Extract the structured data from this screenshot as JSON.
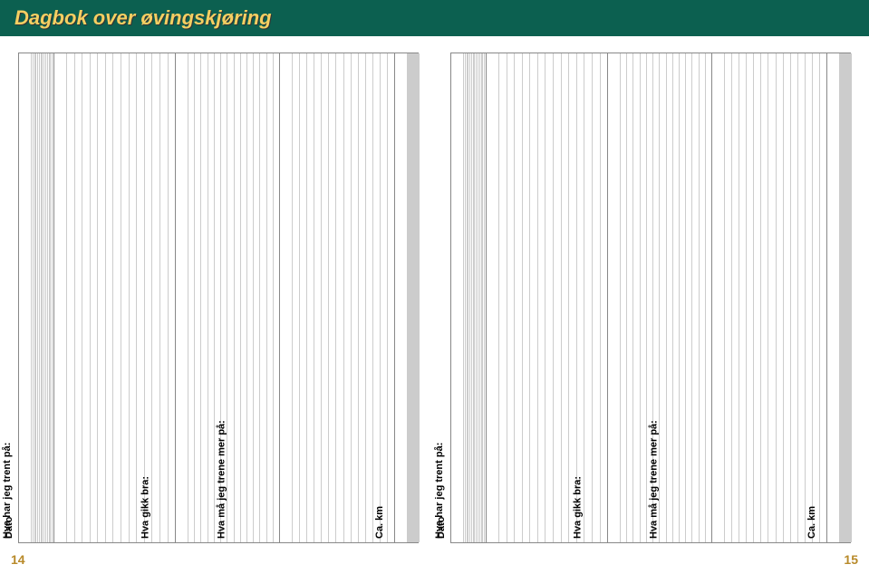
{
  "header": {
    "title": "Dagbok over øvingskjøring"
  },
  "columns": {
    "dato": "Dato",
    "trent": "Hva har jeg trent på:",
    "bra": "Hva gikk bra:",
    "mer": "Hva må jeg trene mer på:",
    "km": "Ca. km"
  },
  "rows_per_page": 14,
  "page_numbers": {
    "left": "14",
    "right": "15"
  }
}
